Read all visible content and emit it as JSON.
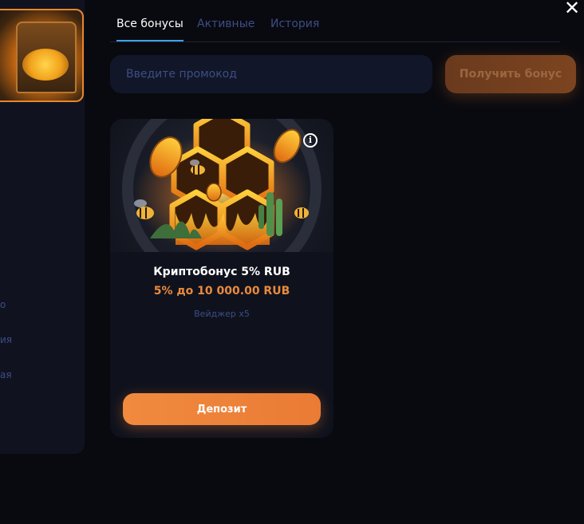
{
  "side": {
    "promo_percent": "%",
    "links": [
      "о",
      "ия",
      "ая"
    ]
  },
  "tabs": [
    {
      "label": "Все бонусы",
      "active": true
    },
    {
      "label": "Активные",
      "active": false
    },
    {
      "label": "История",
      "active": false
    }
  ],
  "promo": {
    "placeholder": "Введите промокод",
    "button_label": "Получить бонус"
  },
  "card": {
    "title": "Криптобонус 5% RUB",
    "amount": "5% до 10 000.00 RUB",
    "wager": "Вейджер x5",
    "deposit_label": "Депозит",
    "info_icon": "info-icon"
  },
  "colors": {
    "accent_orange": "#ea8a3d",
    "tab_active_underline": "#3ea2e8",
    "muted_text": "#3d4d86",
    "background": "#090a10",
    "panel": "#10131f"
  }
}
